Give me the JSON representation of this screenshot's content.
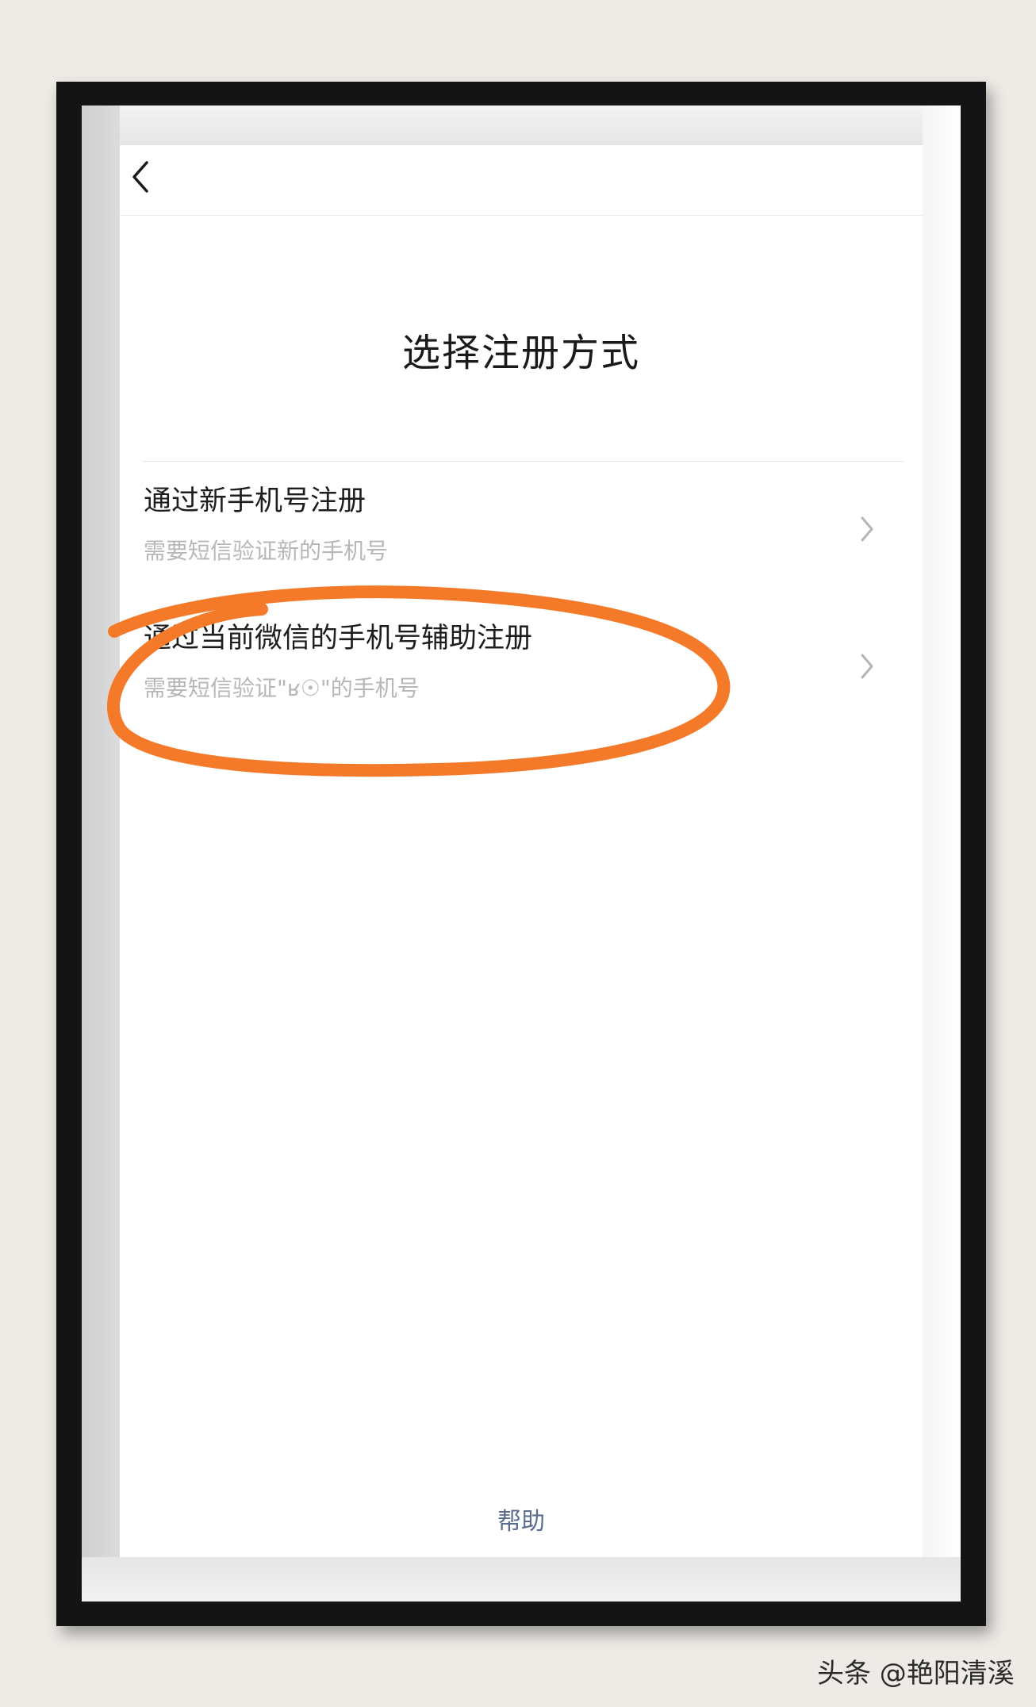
{
  "page": {
    "title": "选择注册方式",
    "help_label": "帮助"
  },
  "options": [
    {
      "title": "通过新手机号注册",
      "subtitle": "需要短信验证新的手机号"
    },
    {
      "title": "通过当前微信的手机号辅助注册",
      "subtitle": "需要短信验证\"ʁ☉\"的手机号"
    }
  ],
  "annotation": {
    "color": "#f47a2a"
  },
  "watermark": "头条 @艳阳清溪",
  "icons": [
    "back-icon",
    "chevron-right-icon"
  ]
}
